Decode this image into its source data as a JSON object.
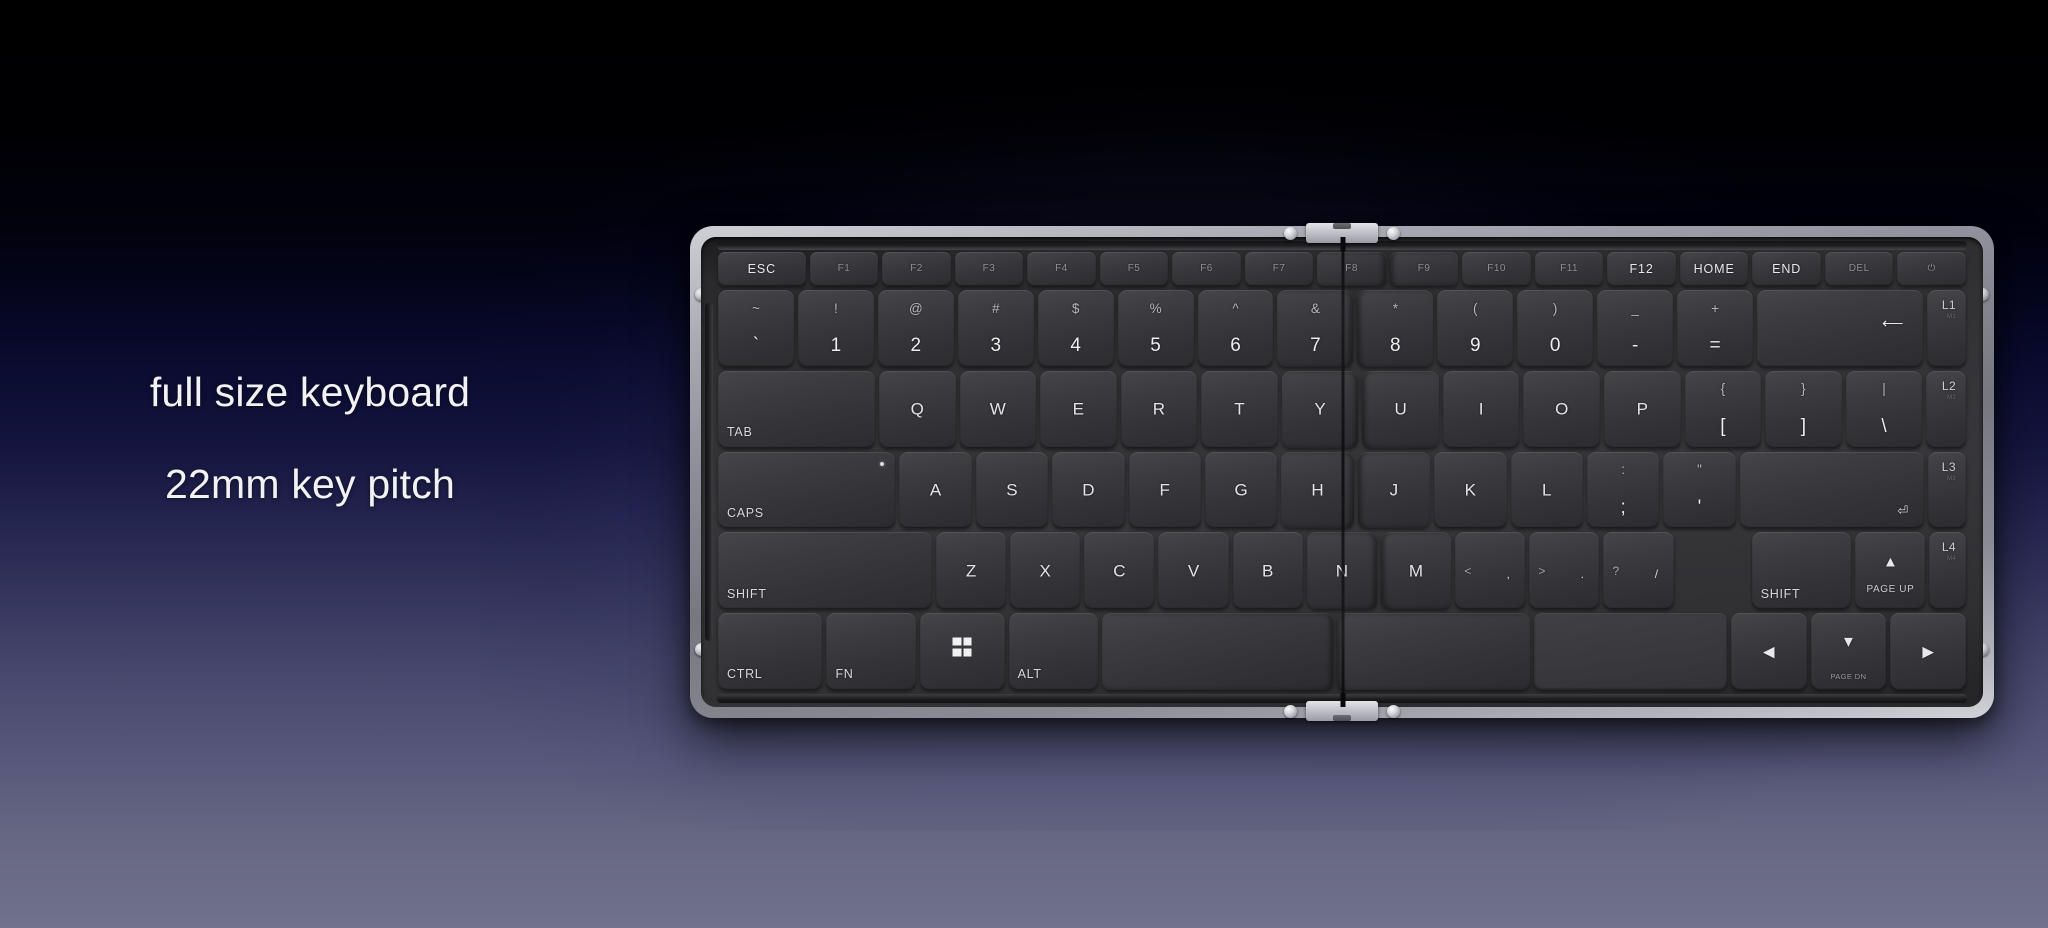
{
  "captions": {
    "line1": "full size keyboard",
    "line2": "22mm key pitch"
  },
  "colors": {
    "background_top": "#000000",
    "background_mid": "#14153f",
    "background_bottom": "#70718b",
    "bezel": "#a9aab3",
    "tray": "#37373b",
    "keycap": "#3c3c41",
    "key_label": "#e4e4e8",
    "key_label_dim": "#8f9096"
  },
  "keyboard": {
    "name": "foldable-full-size-keyboard",
    "fold": "center vertical hinge",
    "rows": {
      "function": [
        {
          "label": "ESC",
          "style": "bright"
        },
        {
          "label": "F1"
        },
        {
          "label": "F2"
        },
        {
          "label": "F3"
        },
        {
          "label": "F4"
        },
        {
          "label": "F5"
        },
        {
          "label": "F6"
        },
        {
          "label": "F7"
        },
        {
          "label": "F8"
        },
        {
          "label": "F9"
        },
        {
          "label": "F10"
        },
        {
          "label": "F11"
        },
        {
          "label": "F12",
          "style": "bright"
        },
        {
          "label": "HOME",
          "style": "bright"
        },
        {
          "label": "END",
          "style": "bright"
        },
        {
          "label": "DEL"
        },
        {
          "label": "⏻",
          "name": "power-key"
        }
      ],
      "number": [
        {
          "up": "~",
          "dn": "`"
        },
        {
          "up": "!",
          "dn": "1"
        },
        {
          "up": "@",
          "dn": "2"
        },
        {
          "up": "#",
          "dn": "3"
        },
        {
          "up": "$",
          "dn": "4"
        },
        {
          "up": "%",
          "dn": "5"
        },
        {
          "up": "^",
          "dn": "6"
        },
        {
          "up": "&",
          "dn": "7"
        },
        {
          "up": "*",
          "dn": "8"
        },
        {
          "up": "(",
          "dn": "9"
        },
        {
          "up": ")",
          "dn": "0"
        },
        {
          "up": "_",
          "dn": "-"
        },
        {
          "up": "+",
          "dn": "="
        },
        {
          "backspace": "⟵",
          "name": "backspace-key"
        },
        {
          "corner": "L1",
          "sub": "M1",
          "name": "layer-1-key"
        }
      ],
      "top": [
        {
          "label": "TAB",
          "align": "bl"
        },
        {
          "label": "Q"
        },
        {
          "label": "W"
        },
        {
          "label": "E"
        },
        {
          "label": "R"
        },
        {
          "label": "T"
        },
        {
          "label": "Y"
        },
        {
          "label": "U"
        },
        {
          "label": "I"
        },
        {
          "label": "O"
        },
        {
          "label": "P"
        },
        {
          "up": "{",
          "dn": "["
        },
        {
          "up": "}",
          "dn": "]"
        },
        {
          "up": "|",
          "dn": "\\"
        },
        {
          "corner": "L2",
          "sub": "M2",
          "name": "layer-2-key"
        }
      ],
      "home": [
        {
          "label": "CAPS",
          "align": "bl",
          "led": true
        },
        {
          "label": "A"
        },
        {
          "label": "S"
        },
        {
          "label": "D"
        },
        {
          "label": "F"
        },
        {
          "label": "G"
        },
        {
          "label": "H"
        },
        {
          "label": "J"
        },
        {
          "label": "K"
        },
        {
          "label": "L"
        },
        {
          "up": ":",
          "dn": ";"
        },
        {
          "up": "\"",
          "dn": "'"
        },
        {
          "enter": "⏎",
          "name": "enter-key"
        },
        {
          "corner": "L3",
          "sub": "M3",
          "name": "layer-3-key"
        }
      ],
      "bottom": [
        {
          "label": "SHIFT",
          "align": "bl",
          "name": "left-shift-key"
        },
        {
          "label": "Z"
        },
        {
          "label": "X"
        },
        {
          "label": "C"
        },
        {
          "label": "V"
        },
        {
          "label": "B"
        },
        {
          "label": "N"
        },
        {
          "label": "M"
        },
        {
          "pair_l": "<",
          "pair_r": ","
        },
        {
          "pair_l": ">",
          "pair_r": "."
        },
        {
          "pair_l": "?",
          "pair_r": "/"
        },
        {
          "label": "SHIFT",
          "align": "bl",
          "name": "right-shift-key"
        },
        {
          "glyph": "▲",
          "sub": "PAGE UP",
          "name": "page-up-key"
        },
        {
          "corner": "L4",
          "sub": "M4",
          "name": "layer-4-key"
        }
      ],
      "modifier": [
        {
          "label": "CTRL",
          "align": "bl"
        },
        {
          "label": "FN",
          "align": "bl"
        },
        {
          "icon": "windows-logo",
          "name": "windows-key"
        },
        {
          "label": "ALT",
          "align": "bl"
        },
        {
          "label": "",
          "name": "spacebar-left"
        },
        {
          "label": "",
          "name": "spacebar-right"
        },
        {
          "trackpad": true,
          "name": "trackpad"
        },
        {
          "glyph": "◀",
          "name": "arrow-left-key"
        },
        {
          "glyph": "▼",
          "sub": "PAGE DN",
          "name": "page-down-key"
        },
        {
          "glyph": "▶",
          "name": "arrow-right-key"
        }
      ]
    }
  }
}
